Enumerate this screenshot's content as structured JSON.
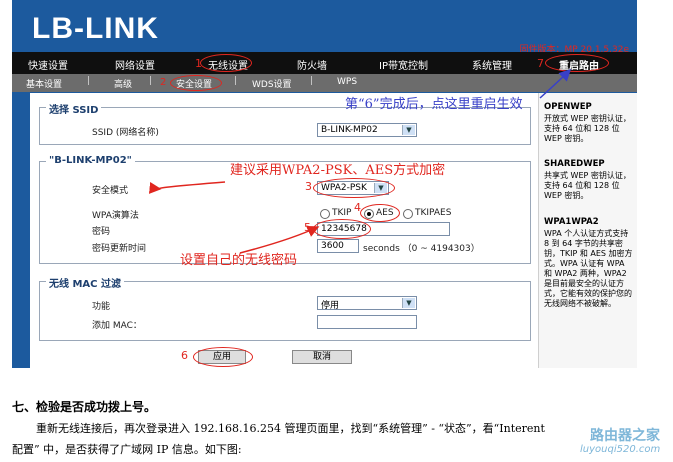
{
  "brand": "LB-LINK",
  "firmware": "固件版本：MP 20.1.5.32e",
  "nav": [
    "快速设置",
    "网络设置",
    "无线设置",
    "防火墙",
    "IP带宽控制",
    "系统管理",
    "重启路由"
  ],
  "subnav": [
    "基本设置",
    "高级",
    "安全设置",
    "WDS设置",
    "WPS"
  ],
  "steps": {
    "s1": "1",
    "s2": "2",
    "s3": "3",
    "s4": "4",
    "s5": "5",
    "s6": "6",
    "s7": "7"
  },
  "ssid_section": {
    "legend": "选择 SSID",
    "label": "SSID (网络名称)",
    "value": "B-LINK-MP02"
  },
  "security_section": {
    "legend": "\"B-LINK-MP02\"",
    "mode_label": "安全模式",
    "mode_value": "WPA2-PSK",
    "algo_label": "WPA演算法",
    "algo_options": [
      "TKIP",
      "AES",
      "TKIPAES"
    ],
    "algo_selected": "AES",
    "key_label": "密码",
    "key_value": "12345678",
    "renew_label": "密码更新时间",
    "renew_value": "3600",
    "renew_unit": "seconds （0 ~ 4194303）"
  },
  "mac_section": {
    "legend": "无线 MAC 过滤",
    "func_label": "功能",
    "func_value": "停用",
    "add_label": "添加 MAC："
  },
  "buttons": {
    "apply": "应用",
    "cancel": "取消"
  },
  "sidebar": {
    "openwep_title": "OPENWEP",
    "openwep_text": "开放式 WEP 密钥认证，支持 64 位和 128 位 WEP 密钥。",
    "sharedwep_title": "SHAREDWEP",
    "sharedwep_text": "共享式 WEP 密钥认证，支持 64 位和 128 位 WEP 密钥。",
    "wpa1wpa2_title": "WPA1WPA2",
    "wpa1wpa2_text": "WPA 个人认证方式支持 8 到 64 字节的共享密钥，TKIP 和 AES 加密方式。WPA 认证有 WPA 和 WPA2 两种，WPA2 是目前最安全的认证方式，它能有效的保护您的无线网络不被破解。"
  },
  "annotations": {
    "restart": "第“6”完成后，点这里重启生效",
    "recommend": "建议采用WPA2-PSK、AES方式加密",
    "setpwd": "设置自己的无线密码"
  },
  "doc": {
    "heading": "七、检验是否成功拨上号。",
    "para_line1": "重新无线连接后，再次登录进入 192.168.16.254 管理页面里，找到“系统管理” - “状态”，看“Interent",
    "para_line2": "配置” 中，是否获得了广域网 IP 信息。如下图:"
  },
  "watermark": {
    "title": "路由器之家",
    "url": "luyouqi520.com"
  }
}
